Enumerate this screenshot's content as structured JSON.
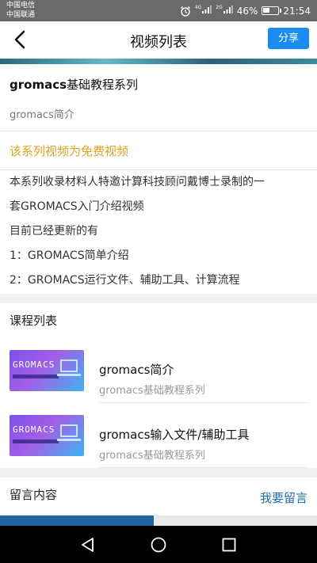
{
  "status": {
    "carrier_1": "中国电信",
    "carrier_2": "中国联通",
    "net_1": "4G",
    "net_2": "2G",
    "battery": "46%",
    "battery_level": 0.46,
    "time": "21:54"
  },
  "header": {
    "title": "视频列表",
    "share_label": "分享"
  },
  "series": {
    "title_en": "gromacs",
    "title_cn": "基础教程系列",
    "subtitle": "gromacs简介",
    "free_note": "该系列视频为免费视频",
    "description": [
      "本系列收录材料人特邀计算科技顾问戴博士录制的一",
      "套GROMACS入门介绍视频",
      "目前已经更新的有",
      "1：GROMACS简单介绍",
      "2：GROMACS运行文件、辅助工具、计算流程"
    ]
  },
  "course_list": {
    "title": "课程列表",
    "items": [
      {
        "name": "gromacs简介",
        "series": "gromacs基础教程系列",
        "thumb_text": "GROMACS"
      },
      {
        "name": "gromacs输入文件/辅助工具",
        "series": "gromacs基础教程系列",
        "thumb_text": "GROMACS"
      }
    ]
  },
  "comments": {
    "title": "留言内容",
    "action": "我要留言"
  },
  "playback": {
    "progress": 0.485
  },
  "colors": {
    "accent": "#1a8cf0",
    "free_note": "#e0a21c",
    "link": "#1f6fae"
  },
  "icons": {
    "back": "back-arrow-icon",
    "nav_back": "nav-back-icon",
    "nav_home": "nav-home-icon",
    "nav_recent": "nav-recent-icon"
  }
}
